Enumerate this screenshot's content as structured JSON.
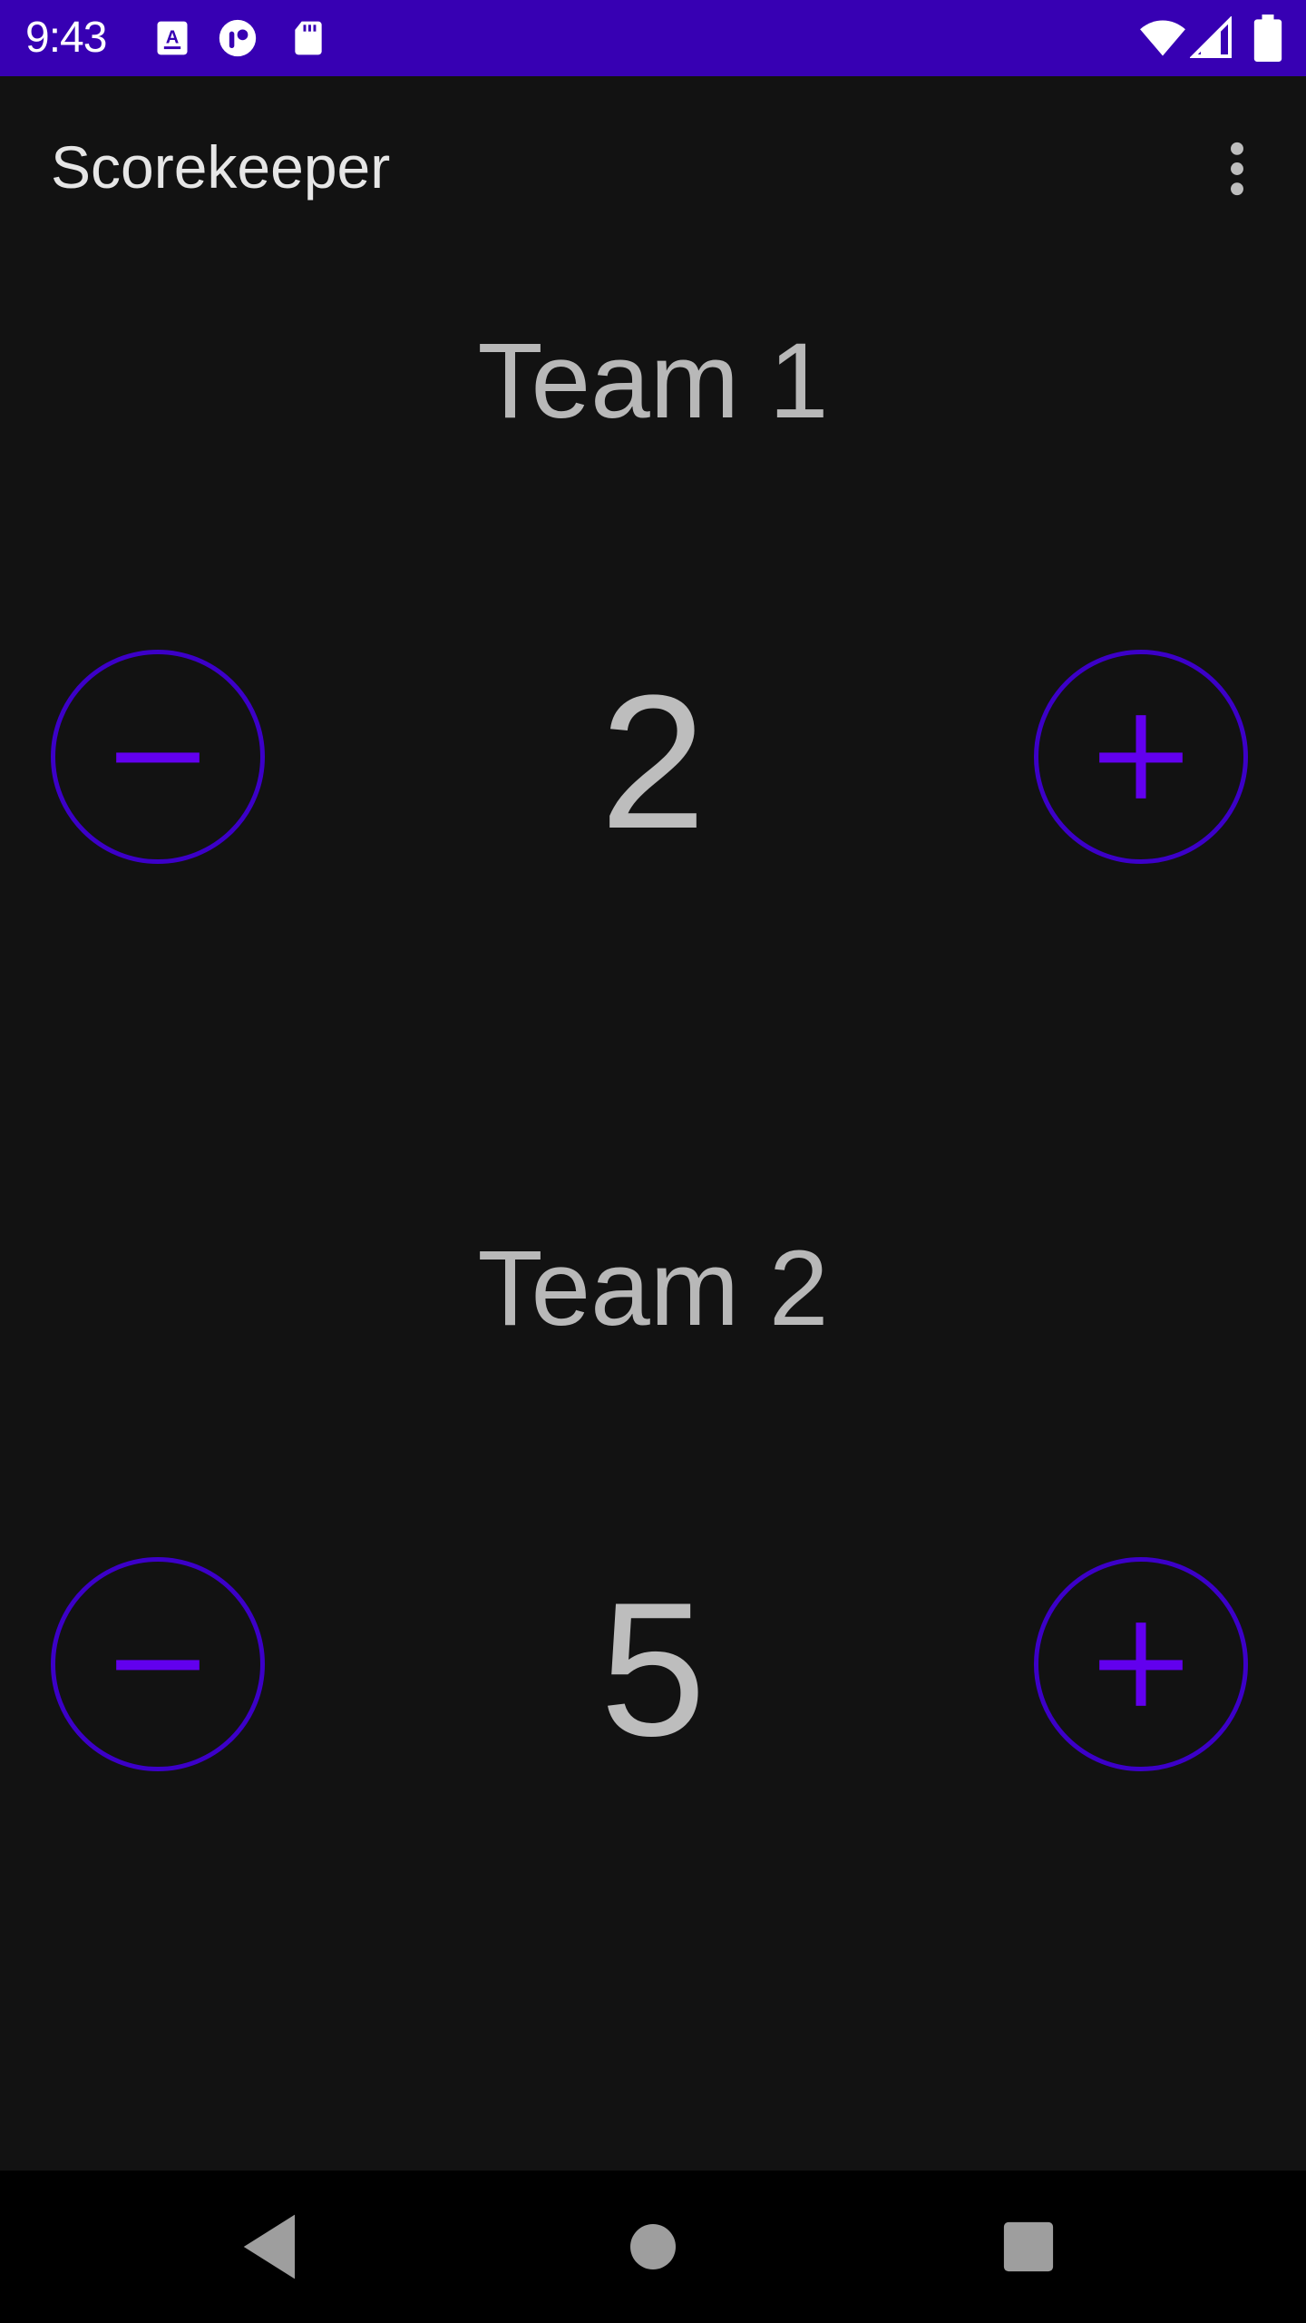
{
  "status_bar": {
    "time": "9:43",
    "icons": [
      "keyboard-a-icon",
      "app-notification-icon",
      "sd-card-icon",
      "wifi-icon",
      "cell-signal-icon",
      "battery-icon"
    ],
    "background": "#3700b3"
  },
  "app_bar": {
    "title": "Scorekeeper",
    "overflow_icon": "more-vert-icon"
  },
  "teams": [
    {
      "name": "Team 1",
      "score": "2",
      "decrement_icon": "minus-icon",
      "increment_icon": "plus-icon"
    },
    {
      "name": "Team 2",
      "score": "5",
      "decrement_icon": "minus-icon",
      "increment_icon": "plus-icon"
    }
  ],
  "nav_bar": {
    "buttons": [
      "back-icon",
      "home-icon",
      "recents-icon"
    ]
  },
  "colors": {
    "accent": "#6200ee",
    "button_outline": "#3c00c8",
    "background": "#121212",
    "text_primary": "#bdbdbd"
  }
}
